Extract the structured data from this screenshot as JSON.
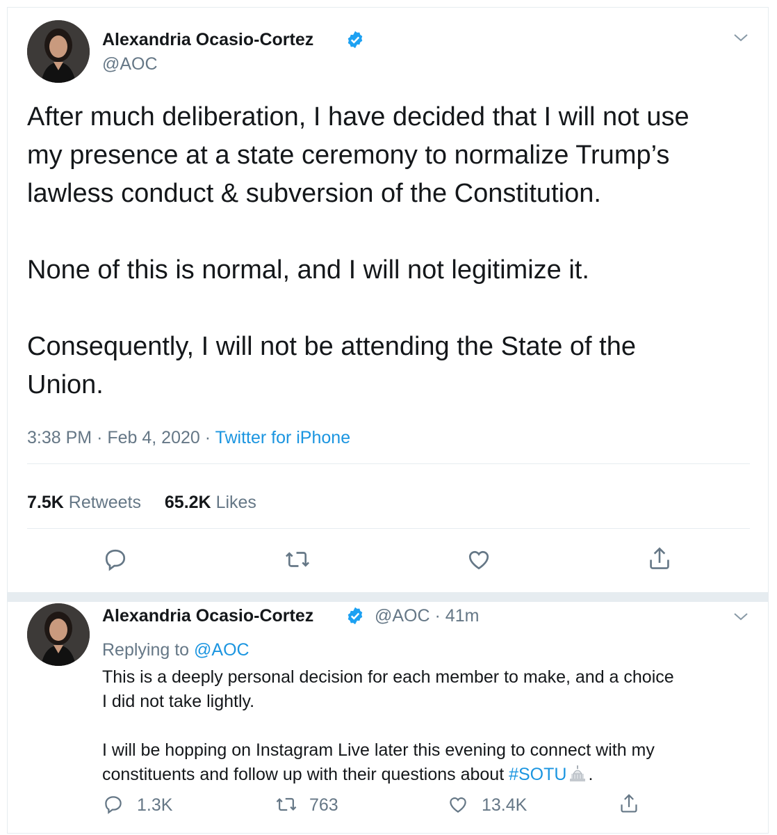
{
  "main_tweet": {
    "author_name": "Alexandria Ocasio-Cortez",
    "handle": "@AOC",
    "text": "After much deliberation, I have decided that I will not use\nmy presence at a state ceremony to normalize Trump’s\nlawless conduct & subversion of the Constitution.\n\nNone of this is normal, and I will not legitimize it.\n\nConsequently, I will not be attending the State of the\nUnion.",
    "time": "3:38 PM",
    "date": "Feb 4, 2020",
    "sep": "·",
    "source": "Twitter for iPhone",
    "retweet_count": "7.5K",
    "retweet_label": "Retweets",
    "like_count": "65.2K",
    "like_label": "Likes",
    "icons": [
      "reply-icon",
      "retweet-icon",
      "like-icon",
      "share-icon"
    ]
  },
  "reply_tweet": {
    "author_name": "Alexandria Ocasio-Cortez",
    "handle": "@AOC",
    "sep": "·",
    "time_ago": "41m",
    "replying_label": "Replying to",
    "replying_to": "@AOC",
    "text_line1": "This is a deeply personal decision for each member to make, and a choice\nI did not take lightly.\n\nI will be hopping on Instagram Live later this evening to connect with my\nconstituents and follow up with their questions about ",
    "hashtag": "#SOTU",
    "text_end": ".",
    "reply_count": "1.3K",
    "retweet_count": "763",
    "like_count": "13.4K"
  },
  "colors": {
    "accent": "#1b95e0",
    "verified": "#1da1f2",
    "muted": "#657786",
    "text": "#14171a",
    "border": "#e6ecf0"
  }
}
